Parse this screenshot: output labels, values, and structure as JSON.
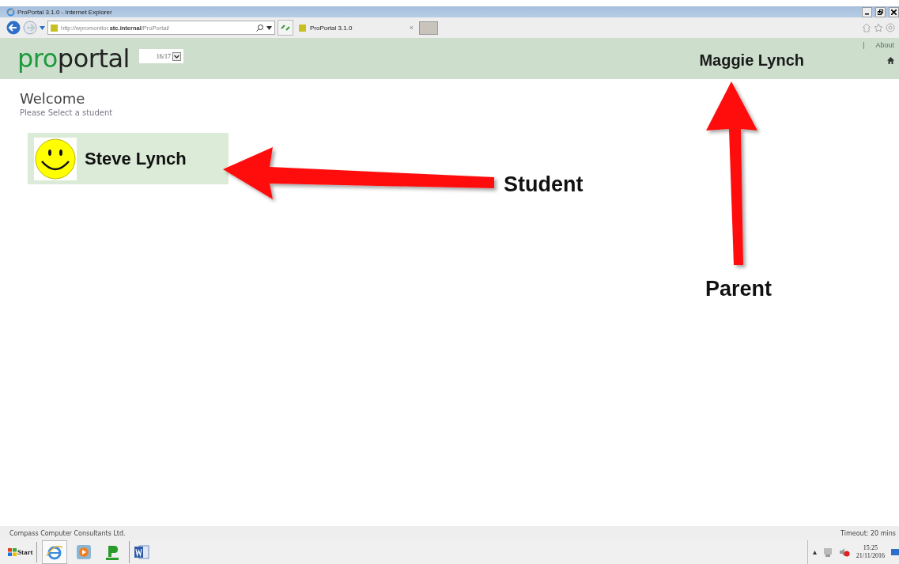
{
  "browser": {
    "title": "ProPortal 3.1.0 - Internet Explorer",
    "url": "http://wpromonitor.**stc.internal**/ProPortal/",
    "tab_title": "ProPortal 3.1.0",
    "tab_close": "×"
  },
  "header": {
    "logo": [
      {
        "text": "pro",
        "color": "#1e9a3c"
      },
      {
        "text": "portal",
        "color": "#222222"
      }
    ],
    "year": "16/17",
    "separator": "|",
    "about": "About",
    "user_name": "Maggie Lynch"
  },
  "content": {
    "heading": "Welcome",
    "subheading": "Please Select a student",
    "students": [
      {
        "name": "Steve Lynch"
      }
    ]
  },
  "annotations": [
    {
      "kind": "left",
      "label": "Student"
    },
    {
      "kind": "up",
      "label": "Parent"
    }
  ],
  "footer": {
    "company": "Compass Computer Consultants Ltd.",
    "timeout": "Timeout: 20 mins"
  },
  "taskbar": {
    "start": "Start",
    "time": "15:25",
    "date": "21/11/2016"
  }
}
